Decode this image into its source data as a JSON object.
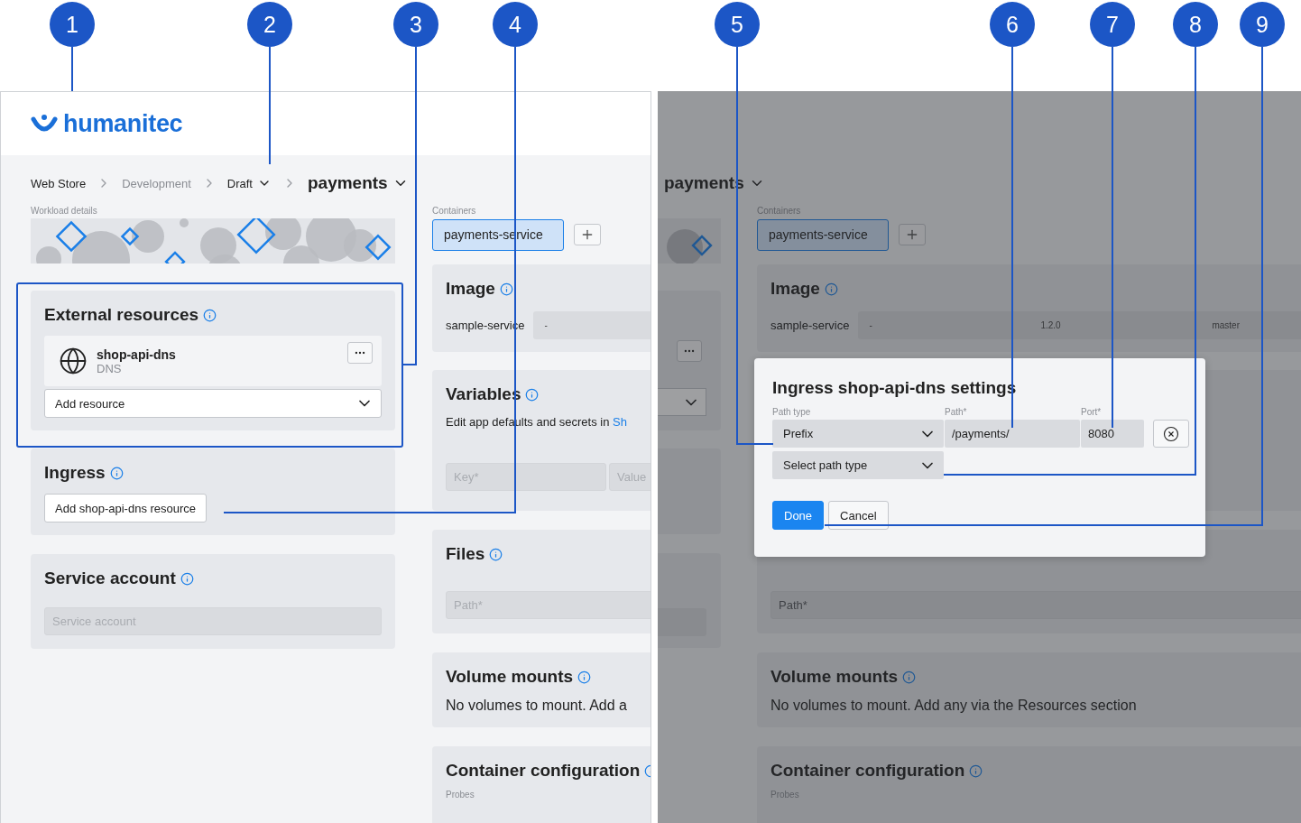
{
  "callouts": [
    "1",
    "2",
    "3",
    "4",
    "5",
    "6",
    "7",
    "8",
    "9"
  ],
  "left_panel": {
    "logo": "humanitec",
    "breadcrumb": [
      {
        "label": "Web Store",
        "kind": "link"
      },
      {
        "label": "Development",
        "kind": "muted"
      },
      {
        "label": "Draft",
        "kind": "dropdown"
      },
      {
        "label": "payments",
        "kind": "title"
      }
    ],
    "workload_label": "Workload details",
    "external_resources": {
      "title": "External resources",
      "resources": [
        {
          "name": "shop-api-dns",
          "type": "DNS"
        }
      ],
      "add_select": "Add resource"
    },
    "ingress": {
      "title": "Ingress",
      "button": "Add shop-api-dns resource"
    },
    "service_account": {
      "title": "Service account",
      "placeholder": "Service account"
    },
    "containers": {
      "label": "Containers",
      "tabs": [
        {
          "label": "payments-service",
          "selected": true
        }
      ]
    },
    "image": {
      "title": "Image",
      "name": "sample-service",
      "fields": [
        "-"
      ]
    },
    "variables": {
      "title": "Variables",
      "text": "Edit app defaults and secrets in ",
      "link": "Sh",
      "key_placeholder": "Key*",
      "value_placeholder": "Value"
    },
    "files": {
      "title": "Files",
      "placeholder": "Path*"
    },
    "volume_mounts": {
      "title": "Volume mounts",
      "text": "No volumes to mount. Add a"
    },
    "container_configuration": {
      "title": "Container configuration",
      "probes_label": "Probes"
    }
  },
  "right_panel": {
    "breadcrumb": [
      {
        "label": "payments",
        "kind": "title"
      }
    ],
    "containers": {
      "label": "Containers",
      "tabs": [
        {
          "label": "payments-service",
          "selected": true
        }
      ]
    },
    "image": {
      "title": "Image",
      "name": "sample-service",
      "fields": [
        "-",
        "1.2.0",
        "master"
      ]
    },
    "files": {
      "placeholder": "Path*"
    },
    "volume_mounts": {
      "title": "Volume mounts",
      "text": "No volumes to mount. Add any via the Resources section"
    },
    "container_configuration": {
      "title": "Container configuration",
      "probes_label": "Probes"
    },
    "dialog": {
      "title": "Ingress shop-api-dns settings",
      "labels": {
        "path_type": "Path type",
        "path": "Path*",
        "port": "Port*"
      },
      "rows": [
        {
          "path_type": "Prefix",
          "path": "/payments/",
          "port": "8080"
        }
      ],
      "add_path_type": "Select path type",
      "buttons": [
        {
          "label": "Done",
          "kind": "primary"
        },
        {
          "label": "Cancel",
          "kind": "secondary"
        }
      ]
    }
  }
}
